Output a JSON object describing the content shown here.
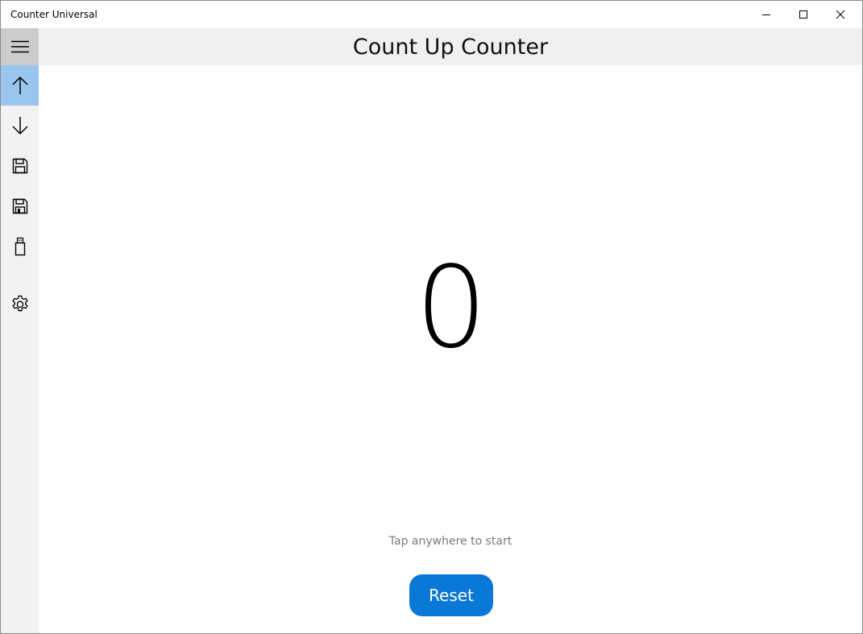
{
  "window": {
    "title": "Counter Universal",
    "controls": {
      "minimize": "minimize-icon",
      "maximize": "maximize-icon",
      "close": "close-icon"
    }
  },
  "nav": {
    "items": [
      {
        "icon": "hamburger-menu-icon",
        "selected": false
      },
      {
        "icon": "arrow-up-icon",
        "selected": true
      },
      {
        "icon": "arrow-down-icon",
        "selected": false
      },
      {
        "icon": "save-icon",
        "selected": false
      },
      {
        "icon": "save-icon",
        "selected": false
      },
      {
        "icon": "usb-drive-icon",
        "selected": false
      },
      {
        "icon": "gear-icon",
        "selected": false
      }
    ],
    "colors": {
      "rail_bg": "#f2f2f2",
      "hamburger_bg": "#cccccc",
      "selected_bg": "#99c5ee"
    }
  },
  "header": {
    "title": "Count Up Counter"
  },
  "main": {
    "counter_value": "0",
    "hint": "Tap anywhere to start",
    "reset_label": "Reset"
  },
  "colors": {
    "accent": "#0a78d7",
    "hint_text": "#7a7a7a",
    "header_bg": "#f0f0f0"
  }
}
